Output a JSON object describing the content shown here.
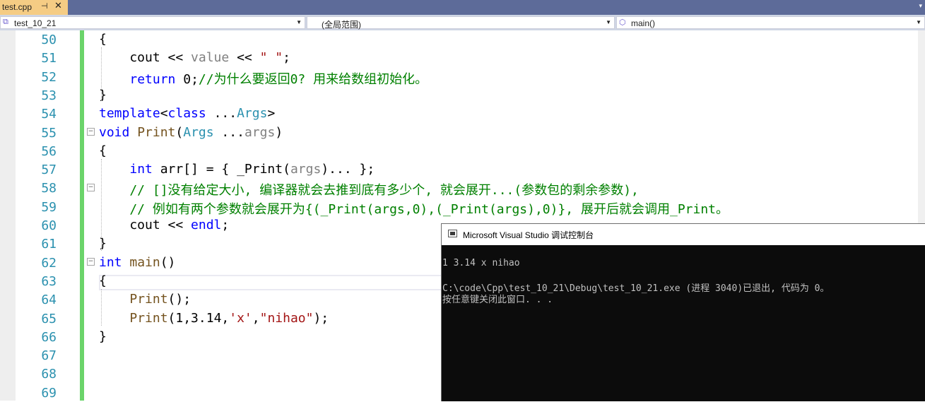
{
  "tab": {
    "filename": "test.cpp",
    "pin": "⊣",
    "close": "✕",
    "overflow": "▾"
  },
  "navbar": {
    "project": "test_10_21",
    "scope": "(全局范围)",
    "member": "main()"
  },
  "editor": {
    "lines": [
      {
        "num": "50",
        "tokens": [
          [
            "",
            "{"
          ]
        ]
      },
      {
        "num": "51",
        "tokens": [
          [
            "",
            "    cout << "
          ],
          [
            "pa",
            "value"
          ],
          [
            "",
            " << "
          ],
          [
            "st",
            "\" \""
          ],
          [
            "",
            ";"
          ]
        ]
      },
      {
        "num": "52",
        "tokens": [
          [
            "",
            "    "
          ],
          [
            "kw",
            "return"
          ],
          [
            "",
            " 0;"
          ],
          [
            "cm",
            "//为什么要返回0? 用来给数组初始化。"
          ]
        ]
      },
      {
        "num": "53",
        "tokens": [
          [
            "",
            "}"
          ]
        ]
      },
      {
        "num": "54",
        "tokens": [
          [
            "kw",
            "template"
          ],
          [
            "",
            "<"
          ],
          [
            "kw",
            "class"
          ],
          [
            "",
            " ..."
          ],
          [
            "ty",
            "Args"
          ],
          [
            "",
            ">"
          ]
        ]
      },
      {
        "num": "55",
        "tokens": [
          [
            "kw",
            "void"
          ],
          [
            "",
            " "
          ],
          [
            "fn",
            "Print"
          ],
          [
            "",
            "("
          ],
          [
            "ty",
            "Args"
          ],
          [
            "",
            " ..."
          ],
          [
            "pa",
            "args"
          ],
          [
            "",
            ")"
          ]
        ]
      },
      {
        "num": "56",
        "tokens": [
          [
            "",
            "{"
          ]
        ]
      },
      {
        "num": "57",
        "tokens": [
          [
            "",
            "    "
          ],
          [
            "kw",
            "int"
          ],
          [
            "",
            " arr[] = { _Print("
          ],
          [
            "pa",
            "args"
          ],
          [
            "",
            ")... };"
          ]
        ]
      },
      {
        "num": "58",
        "tokens": [
          [
            "cm",
            "    // []没有给定大小, 编译器就会去推到底有多少个, 就会展开...(参数包的剩余参数),"
          ]
        ]
      },
      {
        "num": "59",
        "tokens": [
          [
            "cm",
            "    // 例如有两个参数就会展开为{(_Print(args,0),(_Print(args),0)}, 展开后就会调用_Print。"
          ]
        ]
      },
      {
        "num": "60",
        "tokens": [
          [
            "",
            "    cout << "
          ],
          [
            "mb",
            "endl"
          ],
          [
            "",
            ";"
          ]
        ]
      },
      {
        "num": "61",
        "tokens": [
          [
            "",
            "}"
          ]
        ]
      },
      {
        "num": "62",
        "tokens": [
          [
            "kw",
            "int"
          ],
          [
            "",
            " "
          ],
          [
            "fn",
            "main"
          ],
          [
            "",
            "()"
          ]
        ]
      },
      {
        "num": "63",
        "tokens": [
          [
            "",
            "{"
          ]
        ]
      },
      {
        "num": "64",
        "tokens": [
          [
            "",
            "    "
          ],
          [
            "fn",
            "Print"
          ],
          [
            "",
            "();"
          ]
        ]
      },
      {
        "num": "65",
        "tokens": [
          [
            "",
            "    "
          ],
          [
            "fn",
            "Print"
          ],
          [
            "",
            "(1,3.14,"
          ],
          [
            "st",
            "'x'"
          ],
          [
            "",
            ","
          ],
          [
            "st",
            "\"nihao\""
          ],
          [
            "",
            ");"
          ]
        ]
      },
      {
        "num": "66",
        "tokens": [
          [
            "",
            "}"
          ]
        ]
      },
      {
        "num": "67",
        "tokens": []
      },
      {
        "num": "68",
        "tokens": []
      },
      {
        "num": "69",
        "tokens": []
      }
    ]
  },
  "console": {
    "title": "Microsoft Visual Studio 调试控制台",
    "output": [
      "1 3.14 x nihao",
      "",
      "C:\\code\\Cpp\\test_10_21\\Debug\\test_10_21.exe (进程 3040)已退出, 代码为 0。",
      "按任意键关闭此窗口. . ."
    ]
  }
}
